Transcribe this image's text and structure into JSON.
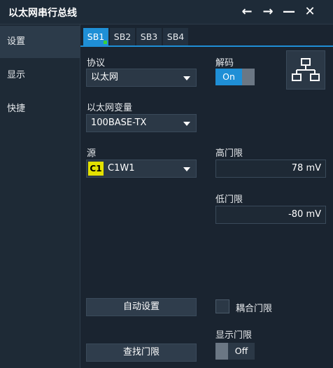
{
  "window": {
    "title": "以太网串行总线",
    "buttons": [
      "←",
      "→",
      "—",
      "✕"
    ]
  },
  "sidebar": {
    "items": [
      {
        "label": "设置",
        "active": true
      },
      {
        "label": "显示",
        "active": false
      },
      {
        "label": "快捷",
        "active": false
      }
    ]
  },
  "tabs": [
    {
      "label": "SB1",
      "active": true
    },
    {
      "label": "SB2",
      "active": false
    },
    {
      "label": "SB3",
      "active": false
    },
    {
      "label": "SB4",
      "active": false
    }
  ],
  "protocol": {
    "label": "协议",
    "value": "以太网"
  },
  "decode": {
    "label": "解码",
    "state": "On"
  },
  "variant": {
    "label": "以太网变量",
    "value": "100BASE-TX"
  },
  "source": {
    "label": "源",
    "badge": "C1",
    "value": "C1W1",
    "badge_color": "#e4e100"
  },
  "high_threshold": {
    "label": "高门限",
    "value": "78 mV"
  },
  "low_threshold": {
    "label": "低门限",
    "value": "-80 mV"
  },
  "auto_setup": {
    "label": "自动设置"
  },
  "couple_threshold": {
    "label": "耦合门限",
    "checked": false
  },
  "show_threshold": {
    "label": "显示门限",
    "state": "Off"
  },
  "find_threshold": {
    "label": "查找门限"
  },
  "colors": {
    "accent": "#1f8fd6",
    "background": "#1a2430",
    "indicator": "#3ad13a"
  },
  "icons": {
    "network": "network-topology-icon"
  }
}
